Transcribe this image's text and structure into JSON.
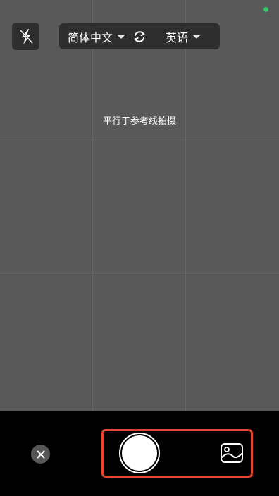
{
  "camera": {
    "source_language": "简体中文",
    "target_language": "英语",
    "hint": "平行于参考线拍摄"
  },
  "icons": {
    "flash": "flash-off-icon",
    "swap": "swap-languages-icon",
    "close": "close-icon",
    "gallery": "image-gallery-icon"
  },
  "colors": {
    "accent_highlight": "#e8442f",
    "status_dot": "#35c46a",
    "viewfinder": "#595959"
  }
}
